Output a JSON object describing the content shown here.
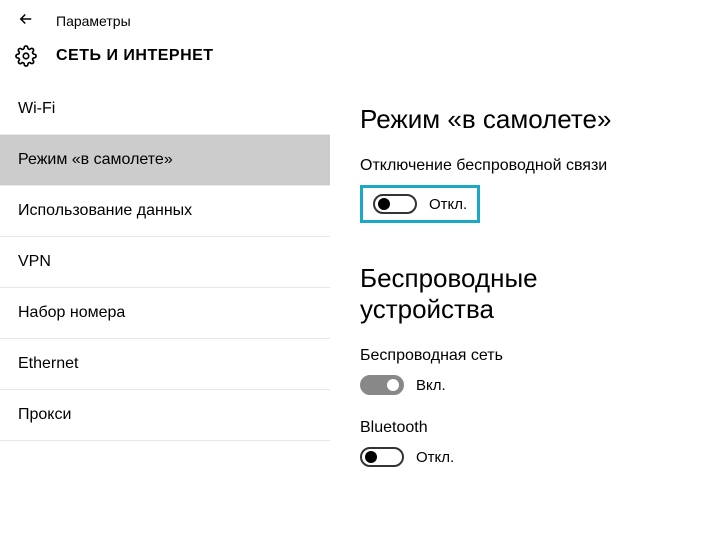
{
  "header": {
    "label": "Параметры",
    "title": "СЕТЬ И ИНТЕРНЕТ"
  },
  "sidebar": {
    "items": [
      {
        "label": "Wi-Fi",
        "selected": false
      },
      {
        "label": "Режим «в самолете»",
        "selected": true
      },
      {
        "label": "Использование данных",
        "selected": false
      },
      {
        "label": "VPN",
        "selected": false
      },
      {
        "label": "Набор номера",
        "selected": false
      },
      {
        "label": "Ethernet",
        "selected": false
      },
      {
        "label": "Прокси",
        "selected": false
      }
    ]
  },
  "main": {
    "heading1": "Режим «в самолете»",
    "airplane": {
      "label": "Отключение беспроводной связи",
      "state": "Откл.",
      "on": false
    },
    "heading2": "Беспроводные устройства",
    "wireless": {
      "label": "Беспроводная сеть",
      "state": "Вкл.",
      "on": true
    },
    "bluetooth": {
      "label": "Bluetooth",
      "state": "Откл.",
      "on": false
    }
  }
}
